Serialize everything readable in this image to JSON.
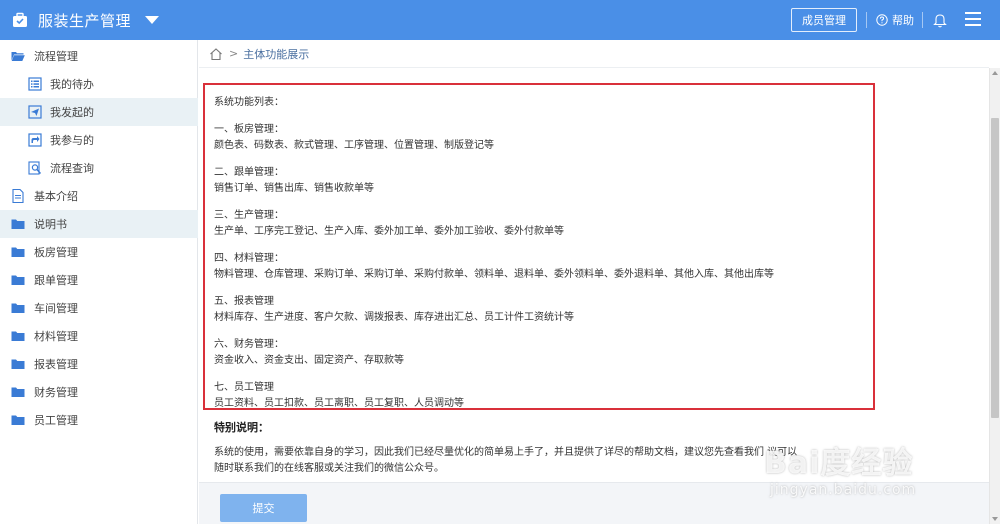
{
  "header": {
    "app_title": "服装生产管理",
    "member_btn": "成员管理",
    "help": "帮助",
    "bg_color": "#4a8fe7"
  },
  "sidebar": {
    "items": [
      {
        "label": "流程管理",
        "icon": "folder-open-icon",
        "level": 0
      },
      {
        "label": "我的待办",
        "icon": "list-icon",
        "level": 1
      },
      {
        "label": "我发起的",
        "icon": "send-icon",
        "level": 1,
        "active": true
      },
      {
        "label": "我参与的",
        "icon": "participate-icon",
        "level": 1
      },
      {
        "label": "流程查询",
        "icon": "search-doc-icon",
        "level": 1
      },
      {
        "label": "基本介绍",
        "icon": "document-icon",
        "level": 0
      },
      {
        "label": "说明书",
        "icon": "folder-icon",
        "level": 0,
        "active": true
      },
      {
        "label": "板房管理",
        "icon": "folder-icon",
        "level": 0
      },
      {
        "label": "跟单管理",
        "icon": "folder-icon",
        "level": 0
      },
      {
        "label": "车间管理",
        "icon": "folder-icon",
        "level": 0
      },
      {
        "label": "材料管理",
        "icon": "folder-icon",
        "level": 0
      },
      {
        "label": "报表管理",
        "icon": "folder-icon",
        "level": 0
      },
      {
        "label": "财务管理",
        "icon": "folder-icon",
        "level": 0
      },
      {
        "label": "员工管理",
        "icon": "folder-icon",
        "level": 0
      }
    ]
  },
  "breadcrumb": {
    "sep": ">",
    "current": "主体功能展示"
  },
  "content": {
    "lines": [
      "系统功能列表：",
      "一、板房管理：",
      "颜色表、码数表、款式管理、工序管理、位置管理、制版登记等",
      "二、跟单管理：",
      "销售订单、销售出库、销售收款单等",
      "三、生产管理：",
      "生产单、工序完工登记、生产入库、委外加工单、委外加工验收、委外付款单等",
      "四、材料管理：",
      "物料管理、仓库管理、采购订单、采购订单、采购付款单、领料单、退料单、委外领料单、委外退料单、其他入库、其他出库等",
      "五、报表管理",
      "材料库存、生产进度、客户欠款、调拨报表、库存进出汇总、员工计件工资统计等",
      "六、财务管理：",
      "资金收入、资金支出、固定资产、存取款等",
      "七、员工管理",
      "员工资料、员工扣款、员工离职、员工复职、人员调动等"
    ],
    "note_title": "特别说明：",
    "note_lines": [
      "系统的使用，需要依靠自身的学习，因此我们已经尽量优化的简单易上手了，并且提供了详尽的帮助文档，建议您先查看我们                  议可以",
      "随时联系我们的在线客服或关注我们的微信公众号。"
    ],
    "highlight_color": "#d9303a"
  },
  "footer": {
    "submit": "提交"
  },
  "watermark": {
    "logo": "Bai度经验",
    "url": "jingyan.baidu.com"
  }
}
